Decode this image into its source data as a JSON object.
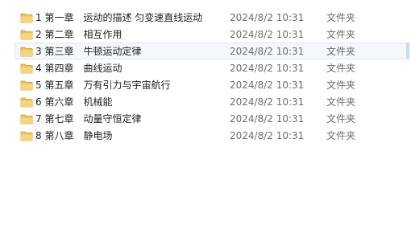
{
  "files": [
    {
      "name": "1 第一章　运动的描述 匀变速直线运动",
      "modified": "2024/8/2 10:31",
      "type": "文件夹",
      "icon": "folder-icon"
    },
    {
      "name": "2 第二章　相互作用",
      "modified": "2024/8/2 10:31",
      "type": "文件夹",
      "icon": "folder-icon"
    },
    {
      "name": "3 第三章　牛顿运动定律",
      "modified": "2024/8/2 10:31",
      "type": "文件夹",
      "icon": "folder-icon"
    },
    {
      "name": "4 第四章　曲线运动",
      "modified": "2024/8/2 10:31",
      "type": "文件夹",
      "icon": "folder-icon"
    },
    {
      "name": "5 第五章　万有引力与宇宙航行",
      "modified": "2024/8/2 10:31",
      "type": "文件夹",
      "icon": "folder-icon"
    },
    {
      "name": "6 第六章　机械能",
      "modified": "2024/8/2 10:31",
      "type": "文件夹",
      "icon": "folder-icon"
    },
    {
      "name": "7 第七章　动量守恒定律",
      "modified": "2024/8/2 10:31",
      "type": "文件夹",
      "icon": "folder-icon"
    },
    {
      "name": "8 第八章　静电场",
      "modified": "2024/8/2 10:31",
      "type": "文件夹",
      "icon": "folder-icon"
    }
  ],
  "colors": {
    "folder_body": "#e9c163",
    "folder_front": "#f6d57c",
    "folder_edge": "#c99a32",
    "hover_border": "#d9e6f3",
    "hover_fill": "#f4f8fc",
    "secondary_text": "#6d6d6d"
  }
}
